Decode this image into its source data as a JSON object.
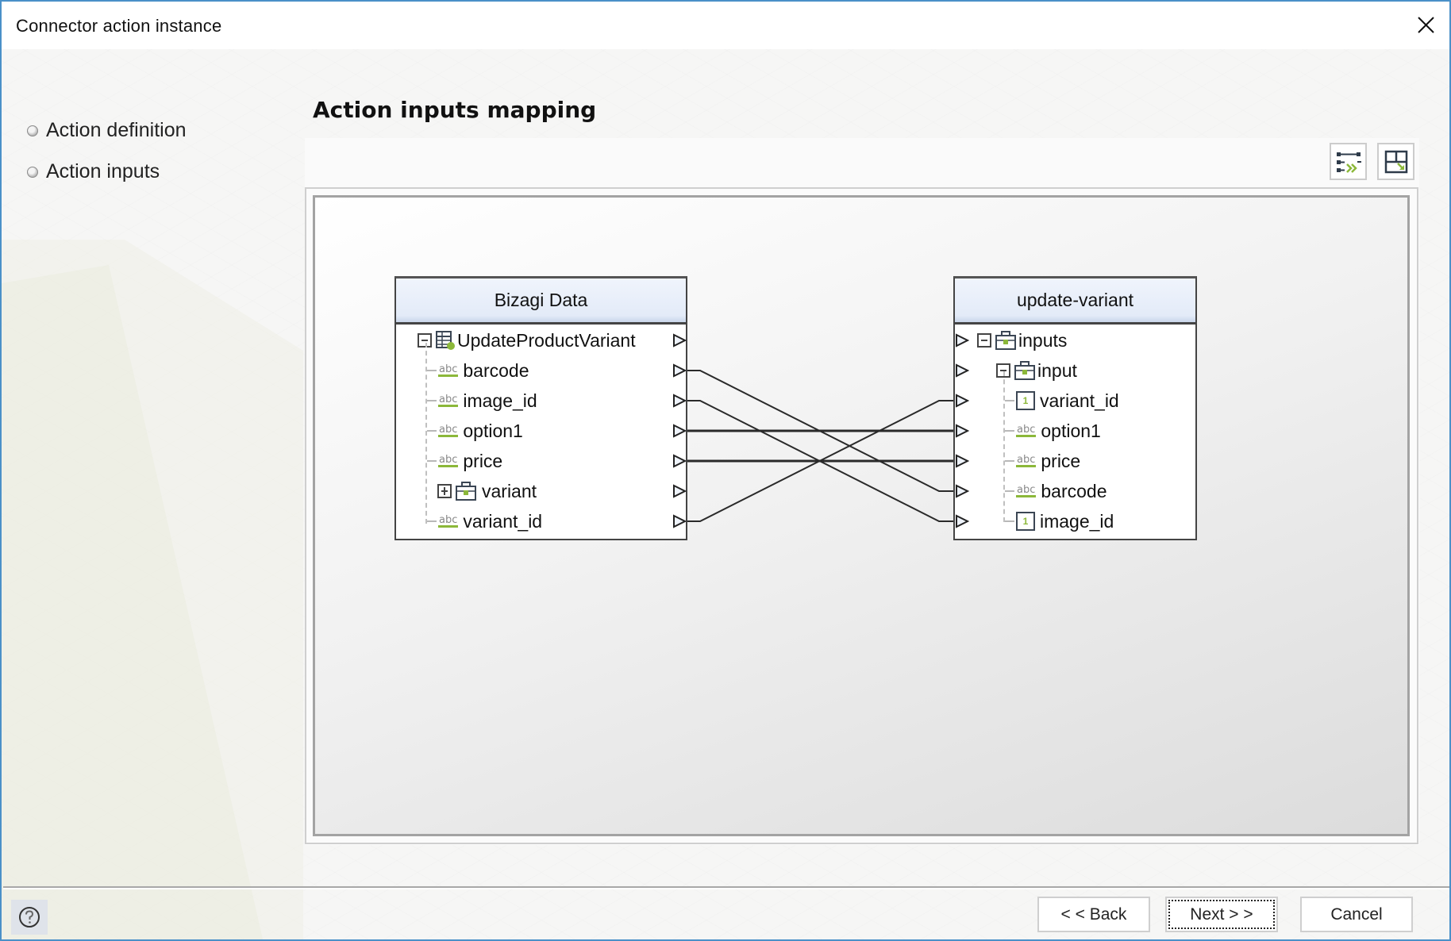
{
  "window": {
    "title": "Connector action instance",
    "close_icon": "close-icon"
  },
  "sidebar": {
    "items": [
      {
        "label": "Action definition",
        "icon": "bullet-icon"
      },
      {
        "label": "Action inputs",
        "icon": "bullet-icon"
      }
    ]
  },
  "main": {
    "heading": "Action inputs mapping",
    "toolbar": {
      "auto_map_icon": "auto-map-icon",
      "layout_icon": "layout-icon"
    }
  },
  "mapping": {
    "source": {
      "title": "Bizagi Data",
      "root": {
        "label": "UpdateProductVariant",
        "icon": "entity-table-icon",
        "expanded": true
      },
      "rows": [
        {
          "label": "barcode",
          "type": "abc"
        },
        {
          "label": "image_id",
          "type": "abc"
        },
        {
          "label": "option1",
          "type": "abc"
        },
        {
          "label": "price",
          "type": "abc"
        },
        {
          "label": "variant",
          "type": "object",
          "expanded": false
        },
        {
          "label": "variant_id",
          "type": "abc"
        }
      ]
    },
    "target": {
      "title": "update-variant",
      "rows": [
        {
          "label": "inputs",
          "type": "object",
          "expanded": true
        },
        {
          "label": "input",
          "type": "object",
          "expanded": true
        },
        {
          "label": "variant_id",
          "type": "number"
        },
        {
          "label": "option1",
          "type": "abc"
        },
        {
          "label": "price",
          "type": "abc"
        },
        {
          "label": "barcode",
          "type": "abc"
        },
        {
          "label": "image_id",
          "type": "number"
        }
      ]
    },
    "connections": [
      {
        "from": "barcode",
        "to": "barcode"
      },
      {
        "from": "image_id",
        "to": "image_id"
      },
      {
        "from": "option1",
        "to": "option1"
      },
      {
        "from": "price",
        "to": "price"
      },
      {
        "from": "variant_id",
        "to": "variant_id"
      }
    ],
    "type_badges": {
      "abc": "abc",
      "number": "1"
    }
  },
  "footer": {
    "help_icon": "help-icon",
    "back_label": "< < Back",
    "next_label": "Next > >",
    "cancel_label": "Cancel"
  }
}
